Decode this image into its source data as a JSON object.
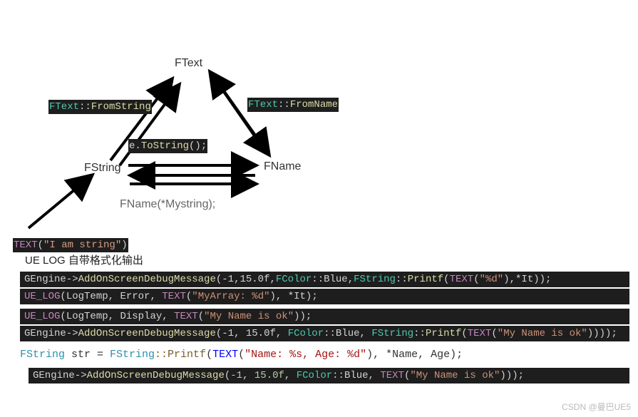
{
  "diagram": {
    "nodes": {
      "ftext": "FText",
      "fstring": "FString",
      "fname": "FName"
    },
    "edges": {
      "ftext_fromstring": "FText::FromString",
      "ftext_fromname": "FText::FromName",
      "tostring": "e.ToString();",
      "fname_ctor": "FName(*Mystring);"
    },
    "input_example": {
      "macro": "TEXT",
      "str": "\"I am string\""
    }
  },
  "section_title": "UE LOG 自带格式化输出",
  "code_samples": {
    "line1": {
      "call": "GEngine->AddOnScreenDebugMessage",
      "args_prefix": "(-1,15.0f,",
      "fcolor": "FColor",
      "fcolor_member": "::Blue",
      "fstring": "FString",
      "printf": "::Printf",
      "text_macro": "TEXT",
      "fmt": "\"%d\"",
      "tail": ",*It));"
    },
    "line2": {
      "macro": "UE_LOG",
      "cat": "LogTemp",
      "level": "Error",
      "text_macro": "TEXT",
      "fmt": "\"MyArray: %d\"",
      "tail": ", *It);"
    },
    "line3": {
      "macro": "UE_LOG",
      "cat": "LogTemp",
      "level": "Display",
      "text_macro": "TEXT",
      "msg": "\"My Name is ok\"",
      "tail": ");"
    },
    "line4": {
      "call": "GEngine->AddOnScreenDebugMessage",
      "args": "(-1, 15.0f, ",
      "fcolor": "FColor",
      "fcolor_member": "::Blue, ",
      "fstring": "FString",
      "printf": "::Printf",
      "text_macro": "TEXT",
      "msg": "\"My Name is ok\"",
      "tail": ")));"
    },
    "line5": {
      "type": "FString",
      "var": " str = ",
      "cls": "FString",
      "fn": "::Printf(",
      "macro": "TEXT",
      "fmt": "\"Name: %s, Age: %d\"",
      "tail": "), *Name, Age);"
    },
    "line6": {
      "call": "GEngine->AddOnScreenDebugMessage",
      "args": "(-1, 15.0f, ",
      "fcolor": "FColor",
      "fcolor_member": "::Blue, ",
      "text_macro": "TEXT",
      "msg": "\"My Name is ok\"",
      "tail": "));"
    }
  },
  "watermark": "CSDN @曼巴UE5"
}
